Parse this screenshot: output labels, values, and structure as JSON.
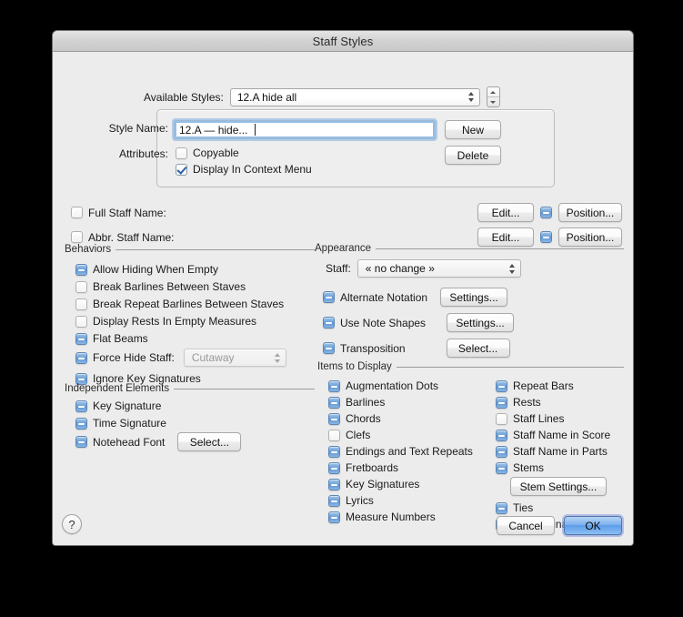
{
  "window": {
    "title": "Staff Styles"
  },
  "available_styles": {
    "label": "Available Styles:",
    "value": "12.A hide all",
    "stepper": "stepper"
  },
  "style_group": {
    "style_name_label": "Style Name:",
    "style_name_value": "12.A — hide...",
    "attributes_label": "Attributes:",
    "copyable_label": "Copyable",
    "copyable_state": "off",
    "display_context_label": "Display In Context Menu",
    "display_context_state": "on",
    "new_button": "New",
    "delete_button": "Delete"
  },
  "staff_names": [
    {
      "label": "Full Staff Name:",
      "state": "off",
      "edit_button": "Edit...",
      "mid_state": "mixed",
      "position_button": "Position..."
    },
    {
      "label": "Abbr. Staff Name:",
      "state": "off",
      "edit_button": "Edit...",
      "mid_state": "mixed",
      "position_button": "Position..."
    }
  ],
  "behaviors": {
    "title": "Behaviors",
    "items": [
      {
        "label": "Allow Hiding When Empty",
        "state": "mixed"
      },
      {
        "label": "Break Barlines Between Staves",
        "state": "off"
      },
      {
        "label": "Break Repeat Barlines Between Staves",
        "state": "off"
      },
      {
        "label": "Display Rests In Empty Measures",
        "state": "off"
      },
      {
        "label": "Flat Beams",
        "state": "mixed"
      },
      {
        "label": "Force Hide Staff:",
        "state": "mixed",
        "popup": "Cutaway",
        "popup_disabled": true
      },
      {
        "label": "Ignore Key Signatures",
        "state": "mixed"
      }
    ]
  },
  "independent_elements": {
    "title": "Independent Elements",
    "items": [
      {
        "label": "Key Signature",
        "state": "mixed"
      },
      {
        "label": "Time Signature",
        "state": "mixed"
      },
      {
        "label": "Notehead Font",
        "state": "mixed",
        "button": "Select..."
      }
    ]
  },
  "appearance": {
    "title": "Appearance",
    "staff_label": "Staff:",
    "staff_value": "« no change »",
    "items": [
      {
        "label": "Alternate Notation",
        "state": "mixed",
        "button": "Settings..."
      },
      {
        "label": "Use Note Shapes",
        "state": "mixed",
        "button": "Settings..."
      },
      {
        "label": "Transposition",
        "state": "mixed",
        "button": "Select..."
      }
    ]
  },
  "items_to_display": {
    "title": "Items to Display",
    "left": [
      {
        "label": "Augmentation Dots",
        "state": "mixed"
      },
      {
        "label": "Barlines",
        "state": "mixed"
      },
      {
        "label": "Chords",
        "state": "mixed"
      },
      {
        "label": "Clefs",
        "state": "off"
      },
      {
        "label": "Endings and Text Repeats",
        "state": "mixed"
      },
      {
        "label": "Fretboards",
        "state": "mixed"
      },
      {
        "label": "Key Signatures",
        "state": "mixed"
      },
      {
        "label": "Lyrics",
        "state": "mixed"
      },
      {
        "label": "Measure Numbers",
        "state": "mixed"
      }
    ],
    "right": [
      {
        "label": "Repeat Bars",
        "state": "mixed"
      },
      {
        "label": "Rests",
        "state": "mixed"
      },
      {
        "label": "Staff Lines",
        "state": "off"
      },
      {
        "label": "Staff Name in Score",
        "state": "mixed"
      },
      {
        "label": "Staff Name in Parts",
        "state": "mixed"
      },
      {
        "label": "Stems",
        "state": "mixed"
      },
      {
        "label": "Ties",
        "state": "mixed"
      },
      {
        "label": "Time Signatures",
        "state": "mixed"
      }
    ],
    "stem_settings_button": "Stem Settings..."
  },
  "footer": {
    "help": "?",
    "cancel": "Cancel",
    "ok": "OK"
  },
  "colors": {
    "window_bg": "#ececec",
    "accent_blue": "#5d9ce8",
    "checkbox_mixed": "#6c9fd6",
    "checkmark": "#2b5fa8"
  }
}
